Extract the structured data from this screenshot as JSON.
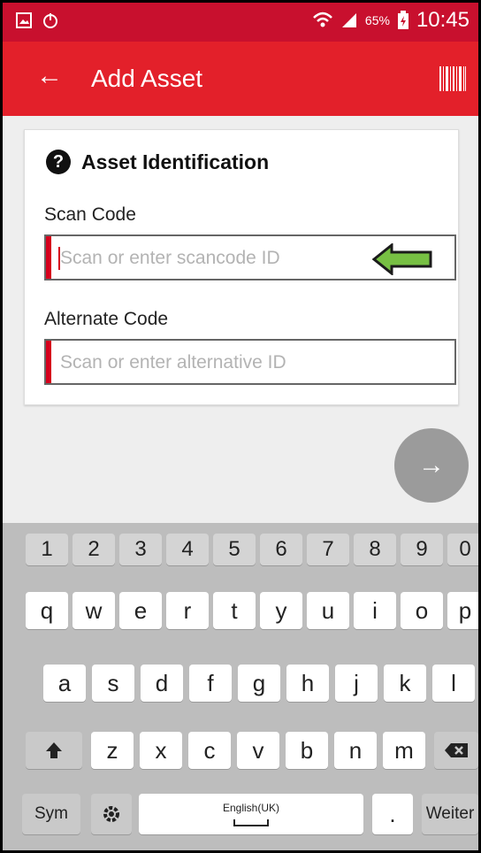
{
  "status_bar": {
    "battery_percent": "65%",
    "time": "10:45"
  },
  "app_bar": {
    "title": "Add Asset",
    "back_icon": "arrow-left-icon",
    "scan_icon": "barcode-icon"
  },
  "form": {
    "section_title": "Asset Identification",
    "section_icon": "question-icon",
    "scan_code": {
      "label": "Scan Code",
      "placeholder": "Scan or enter scancode ID",
      "value": ""
    },
    "alternate_code": {
      "label": "Alternate Code",
      "placeholder": "Scan or enter alternative ID",
      "value": ""
    },
    "next_icon": "arrow-right-icon"
  },
  "keyboard": {
    "numbers": [
      "1",
      "2",
      "3",
      "4",
      "5",
      "6",
      "7",
      "8",
      "9",
      "0"
    ],
    "row1": [
      "q",
      "w",
      "e",
      "r",
      "t",
      "y",
      "u",
      "i",
      "o",
      "p"
    ],
    "row2": [
      "a",
      "s",
      "d",
      "f",
      "g",
      "h",
      "j",
      "k",
      "l"
    ],
    "row3": [
      "z",
      "x",
      "c",
      "v",
      "b",
      "n",
      "m"
    ],
    "sym_label": "Sym",
    "space_label": "English(UK)",
    "period_label": ".",
    "action_label": "Weiter"
  },
  "colors": {
    "brand": "#e3202a",
    "status_bar": "#c8102e",
    "annotation_arrow": "#77c043"
  }
}
